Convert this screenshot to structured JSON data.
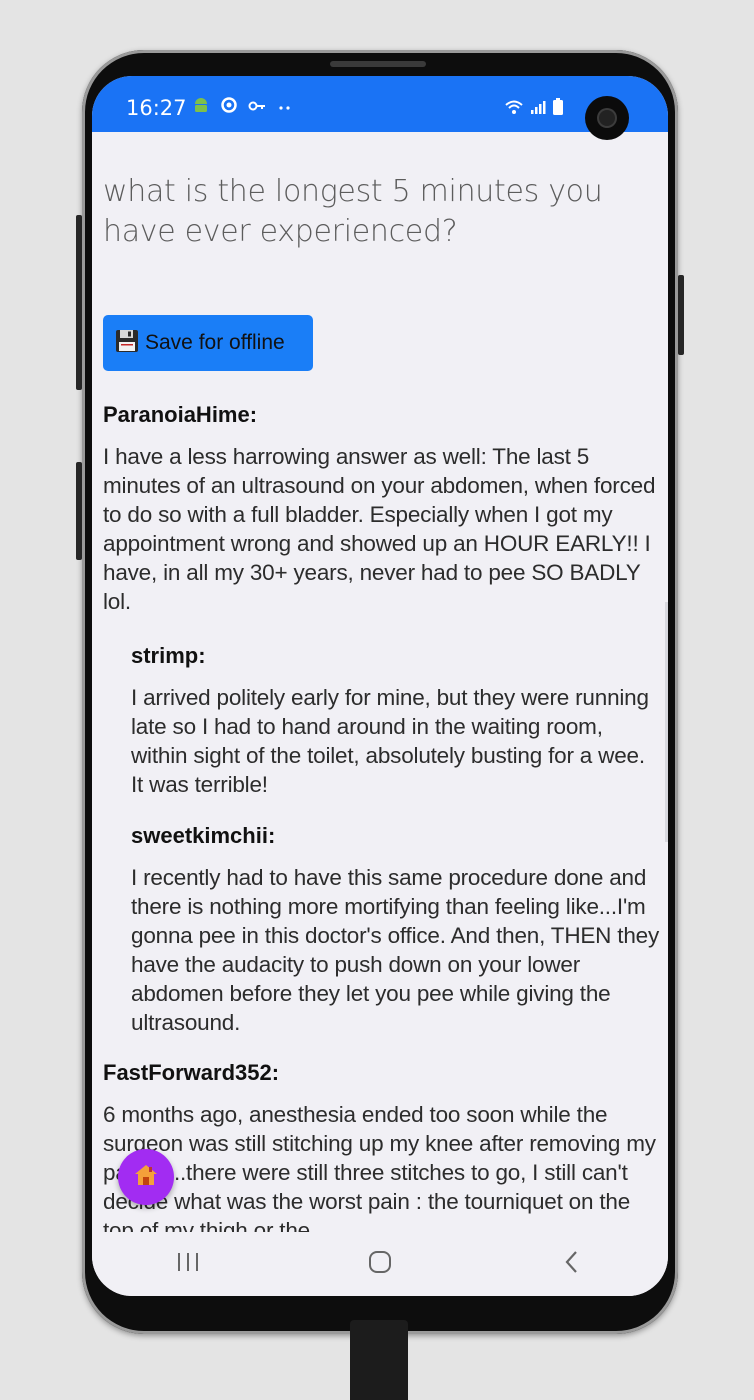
{
  "status_bar": {
    "time": "16:27",
    "icons": [
      "android-icon",
      "sync-icon",
      "key-icon",
      "more-dots-icon"
    ],
    "system_icons": [
      "wifi-icon",
      "signal-icon",
      "battery-icon"
    ],
    "color": "#1a73f5"
  },
  "question": {
    "title": "what is the longest 5 minutes you have ever experienced?"
  },
  "save_button": {
    "icon": "floppy-disk-icon",
    "label": "Save for offline",
    "color": "#1a7ef7"
  },
  "comments": [
    {
      "author": "ParanoiaHime:",
      "text": "I have a less harrowing answer as well: The last 5 minutes of an ultrasound on your abdomen, when forced to do so with a full bladder. Especially when I got my appointment wrong and showed up an HOUR EARLY!! I have, in all my 30+ years, never had to pee SO BADLY lol."
    },
    {
      "author": "strimp:",
      "text": "I arrived politely early for mine, but they were running late so I had to hand around in the waiting room, within sight of the toilet, absolutely busting for a wee. It was terrible!"
    },
    {
      "author": "sweetkimchii:",
      "text": "I recently had to have this same procedure done and there is nothing more mortifying than feeling like...I'm gonna pee in this doctor's office. And then, THEN they have the audacity to push down on your lower abdomen before they let you pee while giving the ultrasound."
    },
    {
      "author": "FastForward352:",
      "text": "6 months ago, anesthesia ended too soon while the surgeon was still stitching up my knee after removing my patella...there were still three stitches to go, I still can't decide what was the worst pain : the tourniquet on the top of my thigh or the"
    }
  ],
  "fab": {
    "icon": "home-icon",
    "color": "#a22cf2"
  },
  "nav_bar": {
    "buttons": [
      "recent-apps-icon",
      "home-circle-icon",
      "back-icon"
    ]
  }
}
